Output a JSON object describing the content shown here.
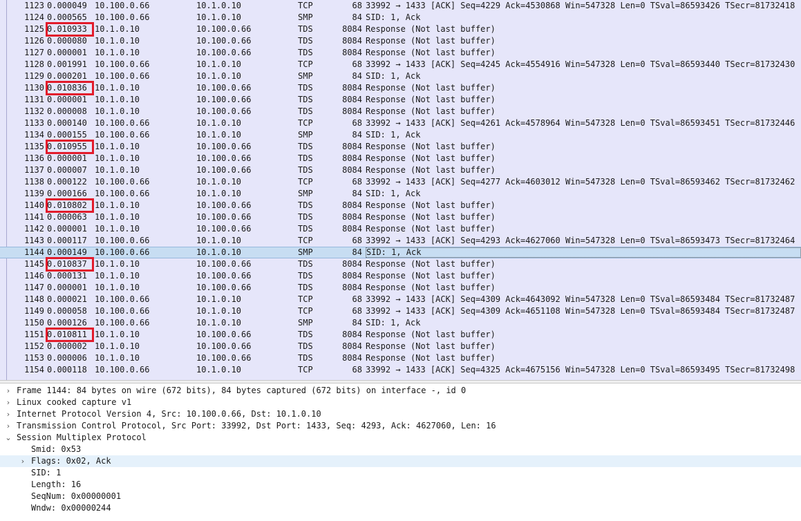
{
  "packets": [
    {
      "no": "1123",
      "time": "0.000049",
      "src": "10.100.0.66",
      "dst": "10.1.0.10",
      "proto": "TCP",
      "len": "68",
      "info": "33992 → 1433 [ACK] Seq=4229 Ack=4530868 Win=547328 Len=0 TSval=86593426 TSecr=81732418",
      "hl": false,
      "sel": false
    },
    {
      "no": "1124",
      "time": "0.000565",
      "src": "10.100.0.66",
      "dst": "10.1.0.10",
      "proto": "SMP",
      "len": "84",
      "info": "SID: 1, Ack",
      "hl": false,
      "sel": false
    },
    {
      "no": "1125",
      "time": "0.010933",
      "src": "10.1.0.10",
      "dst": "10.100.0.66",
      "proto": "TDS",
      "len": "8084",
      "info": "Response (Not last buffer)",
      "hl": true,
      "sel": false
    },
    {
      "no": "1126",
      "time": "0.000080",
      "src": "10.1.0.10",
      "dst": "10.100.0.66",
      "proto": "TDS",
      "len": "8084",
      "info": "Response (Not last buffer)",
      "hl": false,
      "sel": false
    },
    {
      "no": "1127",
      "time": "0.000001",
      "src": "10.1.0.10",
      "dst": "10.100.0.66",
      "proto": "TDS",
      "len": "8084",
      "info": "Response (Not last buffer)",
      "hl": false,
      "sel": false
    },
    {
      "no": "1128",
      "time": "0.001991",
      "src": "10.100.0.66",
      "dst": "10.1.0.10",
      "proto": "TCP",
      "len": "68",
      "info": "33992 → 1433 [ACK] Seq=4245 Ack=4554916 Win=547328 Len=0 TSval=86593440 TSecr=81732430",
      "hl": false,
      "sel": false
    },
    {
      "no": "1129",
      "time": "0.000201",
      "src": "10.100.0.66",
      "dst": "10.1.0.10",
      "proto": "SMP",
      "len": "84",
      "info": "SID: 1, Ack",
      "hl": false,
      "sel": false
    },
    {
      "no": "1130",
      "time": "0.010836",
      "src": "10.1.0.10",
      "dst": "10.100.0.66",
      "proto": "TDS",
      "len": "8084",
      "info": "Response (Not last buffer)",
      "hl": true,
      "sel": false
    },
    {
      "no": "1131",
      "time": "0.000001",
      "src": "10.1.0.10",
      "dst": "10.100.0.66",
      "proto": "TDS",
      "len": "8084",
      "info": "Response (Not last buffer)",
      "hl": false,
      "sel": false
    },
    {
      "no": "1132",
      "time": "0.000008",
      "src": "10.1.0.10",
      "dst": "10.100.0.66",
      "proto": "TDS",
      "len": "8084",
      "info": "Response (Not last buffer)",
      "hl": false,
      "sel": false
    },
    {
      "no": "1133",
      "time": "0.000140",
      "src": "10.100.0.66",
      "dst": "10.1.0.10",
      "proto": "TCP",
      "len": "68",
      "info": "33992 → 1433 [ACK] Seq=4261 Ack=4578964 Win=547328 Len=0 TSval=86593451 TSecr=81732446",
      "hl": false,
      "sel": false
    },
    {
      "no": "1134",
      "time": "0.000155",
      "src": "10.100.0.66",
      "dst": "10.1.0.10",
      "proto": "SMP",
      "len": "84",
      "info": "SID: 1, Ack",
      "hl": false,
      "sel": false
    },
    {
      "no": "1135",
      "time": "0.010955",
      "src": "10.1.0.10",
      "dst": "10.100.0.66",
      "proto": "TDS",
      "len": "8084",
      "info": "Response (Not last buffer)",
      "hl": true,
      "sel": false
    },
    {
      "no": "1136",
      "time": "0.000001",
      "src": "10.1.0.10",
      "dst": "10.100.0.66",
      "proto": "TDS",
      "len": "8084",
      "info": "Response (Not last buffer)",
      "hl": false,
      "sel": false
    },
    {
      "no": "1137",
      "time": "0.000007",
      "src": "10.1.0.10",
      "dst": "10.100.0.66",
      "proto": "TDS",
      "len": "8084",
      "info": "Response (Not last buffer)",
      "hl": false,
      "sel": false
    },
    {
      "no": "1138",
      "time": "0.000122",
      "src": "10.100.0.66",
      "dst": "10.1.0.10",
      "proto": "TCP",
      "len": "68",
      "info": "33992 → 1433 [ACK] Seq=4277 Ack=4603012 Win=547328 Len=0 TSval=86593462 TSecr=81732462",
      "hl": false,
      "sel": false
    },
    {
      "no": "1139",
      "time": "0.000166",
      "src": "10.100.0.66",
      "dst": "10.1.0.10",
      "proto": "SMP",
      "len": "84",
      "info": "SID: 1, Ack",
      "hl": false,
      "sel": false
    },
    {
      "no": "1140",
      "time": "0.010802",
      "src": "10.1.0.10",
      "dst": "10.100.0.66",
      "proto": "TDS",
      "len": "8084",
      "info": "Response (Not last buffer)",
      "hl": true,
      "sel": false
    },
    {
      "no": "1141",
      "time": "0.000063",
      "src": "10.1.0.10",
      "dst": "10.100.0.66",
      "proto": "TDS",
      "len": "8084",
      "info": "Response (Not last buffer)",
      "hl": false,
      "sel": false
    },
    {
      "no": "1142",
      "time": "0.000001",
      "src": "10.1.0.10",
      "dst": "10.100.0.66",
      "proto": "TDS",
      "len": "8084",
      "info": "Response (Not last buffer)",
      "hl": false,
      "sel": false
    },
    {
      "no": "1143",
      "time": "0.000117",
      "src": "10.100.0.66",
      "dst": "10.1.0.10",
      "proto": "TCP",
      "len": "68",
      "info": "33992 → 1433 [ACK] Seq=4293 Ack=4627060 Win=547328 Len=0 TSval=86593473 TSecr=81732464",
      "hl": false,
      "sel": false
    },
    {
      "no": "1144",
      "time": "0.000149",
      "src": "10.100.0.66",
      "dst": "10.1.0.10",
      "proto": "SMP",
      "len": "84",
      "info": "SID: 1, Ack",
      "hl": false,
      "sel": true
    },
    {
      "no": "1145",
      "time": "0.010837",
      "src": "10.1.0.10",
      "dst": "10.100.0.66",
      "proto": "TDS",
      "len": "8084",
      "info": "Response (Not last buffer)",
      "hl": true,
      "sel": false
    },
    {
      "no": "1146",
      "time": "0.000131",
      "src": "10.1.0.10",
      "dst": "10.100.0.66",
      "proto": "TDS",
      "len": "8084",
      "info": "Response (Not last buffer)",
      "hl": false,
      "sel": false
    },
    {
      "no": "1147",
      "time": "0.000001",
      "src": "10.1.0.10",
      "dst": "10.100.0.66",
      "proto": "TDS",
      "len": "8084",
      "info": "Response (Not last buffer)",
      "hl": false,
      "sel": false
    },
    {
      "no": "1148",
      "time": "0.000021",
      "src": "10.100.0.66",
      "dst": "10.1.0.10",
      "proto": "TCP",
      "len": "68",
      "info": "33992 → 1433 [ACK] Seq=4309 Ack=4643092 Win=547328 Len=0 TSval=86593484 TSecr=81732487",
      "hl": false,
      "sel": false
    },
    {
      "no": "1149",
      "time": "0.000058",
      "src": "10.100.0.66",
      "dst": "10.1.0.10",
      "proto": "TCP",
      "len": "68",
      "info": "33992 → 1433 [ACK] Seq=4309 Ack=4651108 Win=547328 Len=0 TSval=86593484 TSecr=81732487",
      "hl": false,
      "sel": false
    },
    {
      "no": "1150",
      "time": "0.000126",
      "src": "10.100.0.66",
      "dst": "10.1.0.10",
      "proto": "SMP",
      "len": "84",
      "info": "SID: 1, Ack",
      "hl": false,
      "sel": false
    },
    {
      "no": "1151",
      "time": "0.010811",
      "src": "10.1.0.10",
      "dst": "10.100.0.66",
      "proto": "TDS",
      "len": "8084",
      "info": "Response (Not last buffer)",
      "hl": true,
      "sel": false
    },
    {
      "no": "1152",
      "time": "0.000002",
      "src": "10.1.0.10",
      "dst": "10.100.0.66",
      "proto": "TDS",
      "len": "8084",
      "info": "Response (Not last buffer)",
      "hl": false,
      "sel": false
    },
    {
      "no": "1153",
      "time": "0.000006",
      "src": "10.1.0.10",
      "dst": "10.100.0.66",
      "proto": "TDS",
      "len": "8084",
      "info": "Response (Not last buffer)",
      "hl": false,
      "sel": false
    },
    {
      "no": "1154",
      "time": "0.000118",
      "src": "10.100.0.66",
      "dst": "10.1.0.10",
      "proto": "TCP",
      "len": "68",
      "info": "33992 → 1433 [ACK] Seq=4325 Ack=4675156 Win=547328 Len=0 TSval=86593495 TSecr=81732498",
      "hl": false,
      "sel": false
    }
  ],
  "details": [
    {
      "text": "Frame 1144: 84 bytes on wire (672 bits), 84 bytes captured (672 bits) on interface -, id 0",
      "level": 0,
      "arrow": "collapsed",
      "hover": false
    },
    {
      "text": "Linux cooked capture v1",
      "level": 0,
      "arrow": "collapsed",
      "hover": false
    },
    {
      "text": "Internet Protocol Version 4, Src: 10.100.0.66, Dst: 10.1.0.10",
      "level": 0,
      "arrow": "collapsed",
      "hover": false
    },
    {
      "text": "Transmission Control Protocol, Src Port: 33992, Dst Port: 1433, Seq: 4293, Ack: 4627060, Len: 16",
      "level": 0,
      "arrow": "collapsed",
      "hover": false
    },
    {
      "text": "Session Multiplex Protocol",
      "level": 0,
      "arrow": "expanded",
      "hover": false
    },
    {
      "text": "Smid: 0x53",
      "level": 1,
      "arrow": "none",
      "hover": false
    },
    {
      "text": "Flags: 0x02, Ack",
      "level": 1,
      "arrow": "collapsed",
      "hover": true
    },
    {
      "text": "SID: 1",
      "level": 1,
      "arrow": "none",
      "hover": false
    },
    {
      "text": "Length: 16",
      "level": 1,
      "arrow": "none",
      "hover": false
    },
    {
      "text": "SeqNum: 0x00000001",
      "level": 1,
      "arrow": "none",
      "hover": false
    },
    {
      "text": "Wndw: 0x00000244",
      "level": 1,
      "arrow": "none",
      "hover": false
    }
  ],
  "icons": {
    "collapsed": "chevron-right-icon",
    "expanded": "chevron-down-icon"
  },
  "colors": {
    "list_bg": "#e6e6fa",
    "selected_bg": "#c7ddf2",
    "highlight_box": "#e21b2b",
    "hover_bg": "#e5f1fb"
  }
}
